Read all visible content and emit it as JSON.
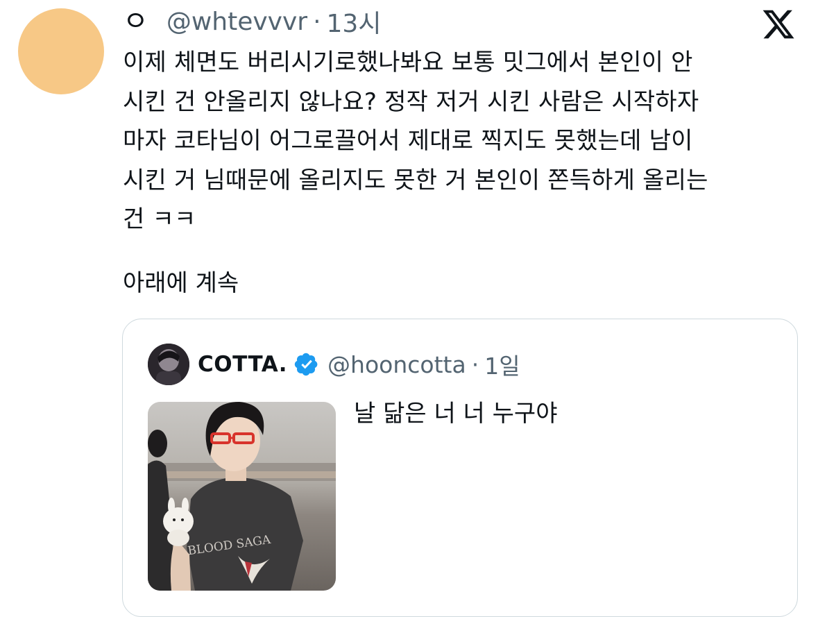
{
  "tweet": {
    "avatar_color": "#f7c886",
    "display_name": "ㅇ",
    "handle": "@whtevvvr",
    "separator": "·",
    "time": "13시",
    "text": "이제 체면도 버리시기로했나봐요 보통 밋그에서 본인이 안\n시킨 건 안올리지 않나요? 정작 저거 시킨 사람은 시작하자\n마자 코타님이 어그로끌어서 제대로 찍지도 못했는데 남이\n시킨 거 님때문에 올리지도 못한 거 본인이 쫀득하게 올리는\n건 ㅋㅋ",
    "continued": "아래에 계속",
    "platform_icon": "x-logo-icon"
  },
  "quoted_tweet": {
    "display_name": "COTTA.",
    "verified": true,
    "verified_color": "#1d9bf0",
    "handle": "@hooncotta",
    "separator": "·",
    "time": "1일",
    "text": "날 닮은 너 너 누구야",
    "photo_shirt_text": "BLOOD SAGA"
  },
  "colors": {
    "text_primary": "#0f1419",
    "text_secondary": "#536471",
    "border": "#cfd9de"
  }
}
